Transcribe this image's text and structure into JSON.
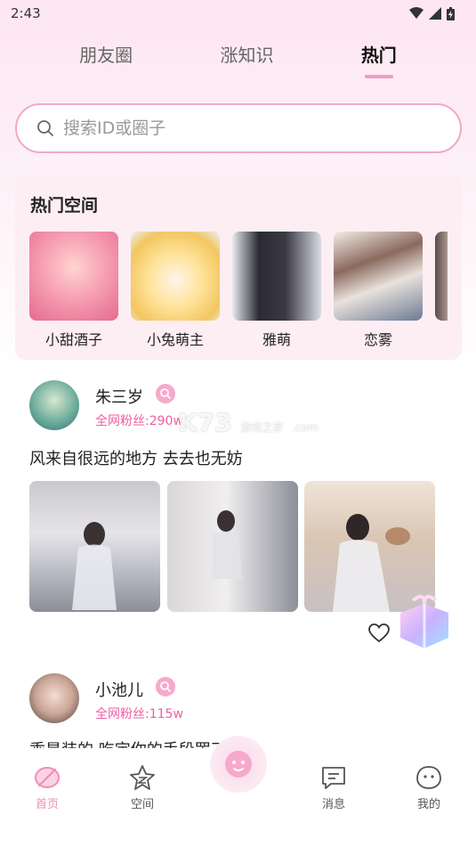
{
  "status": {
    "time": "2:43"
  },
  "tabs": [
    {
      "label": "朋友圈",
      "active": false
    },
    {
      "label": "涨知识",
      "active": false
    },
    {
      "label": "热门",
      "active": true
    }
  ],
  "search": {
    "placeholder": "搜索ID或圈子"
  },
  "hot_spaces": {
    "title": "热门空间",
    "items": [
      {
        "name": "小甜酒子"
      },
      {
        "name": "小兔萌主"
      },
      {
        "name": "雅萌"
      },
      {
        "name": "恋雾"
      }
    ]
  },
  "posts": [
    {
      "username": "朱三岁",
      "fans": "全网粉丝:290w",
      "text": "风来自很远的地方 去去也无妨"
    },
    {
      "username": "小池儿",
      "fans": "全网粉丝:115w",
      "text": "乖是装的 吃定你的手段罢了"
    }
  ],
  "watermark": {
    "brand": "K73",
    "sub": "游戏之家",
    "domain": ".com"
  },
  "nav": [
    {
      "label": "首页",
      "icon": "home-leaf-icon",
      "active": true
    },
    {
      "label": "空间",
      "icon": "star-icon",
      "active": false
    },
    {
      "label": "消息",
      "icon": "message-icon",
      "active": false
    },
    {
      "label": "我的",
      "icon": "smile-face-icon",
      "active": false
    }
  ],
  "colors": {
    "accent": "#f29ac4",
    "fans": "#ee5ea3",
    "card_bg": "#fdeef4"
  }
}
